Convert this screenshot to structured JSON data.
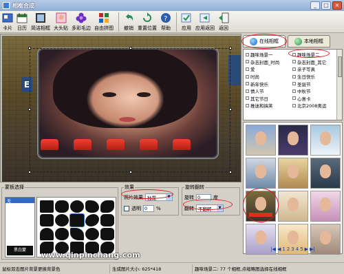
{
  "window": {
    "title": "相框合成",
    "title_icon": "app-icon",
    "controls": [
      "_",
      "□",
      "×"
    ]
  },
  "toolbar": {
    "buttons": [
      {
        "label": "卡片",
        "icon": "card-icon"
      },
      {
        "label": "日历",
        "icon": "calendar-icon"
      },
      {
        "label": "简洁相框",
        "icon": "simple-frame-icon"
      },
      {
        "label": "大头贴",
        "icon": "sticker-icon"
      },
      {
        "label": "多彩毛边",
        "icon": "flower-icon"
      },
      {
        "label": "自由拼图",
        "icon": "puzzle-icon"
      },
      {
        "label": "撤销",
        "icon": "undo-icon"
      },
      {
        "label": "重置位置",
        "icon": "reset-icon"
      },
      {
        "label": "帮助",
        "icon": "help-icon"
      },
      {
        "label": "应用",
        "icon": "apply-icon"
      },
      {
        "label": "应用返回",
        "icon": "apply-return-icon"
      },
      {
        "label": "返回",
        "icon": "return-icon"
      }
    ]
  },
  "right_panel": {
    "tabs": [
      {
        "label": "在线相框",
        "icon": "globe-online-icon",
        "active": true
      },
      {
        "label": "本地相框",
        "icon": "globe-local-icon",
        "active": false
      }
    ],
    "categories": [
      [
        "趣味场景一",
        "趣味场景二"
      ],
      [
        "杂志封面_时尚",
        "杂志封面_其它"
      ],
      [
        "爱",
        "亲子写真"
      ],
      [
        "时尚",
        "生日快乐"
      ],
      [
        "新年快乐",
        "圣诞节"
      ],
      [
        "情人节",
        "中秋节"
      ],
      [
        "其它节日",
        "心意卡"
      ],
      [
        "推迷和搞笑",
        "北京2008奥运"
      ]
    ],
    "pager": {
      "first": "|◀",
      "prev": "◀",
      "pages": [
        "1",
        "2",
        "3",
        "4",
        "5"
      ],
      "next": "▶",
      "last": "▶|"
    }
  },
  "mask_panel": {
    "legend": "蒙板选择",
    "list_items": [
      "无",
      "",
      "",
      "",
      ""
    ],
    "black_button": "黑白蒙"
  },
  "effect_panel": {
    "legend": "效果",
    "photo_effect_label": "照片效果",
    "photo_effect_value": "独霓",
    "transparency_label": "透明",
    "transparency_value": "0",
    "percent": "%"
  },
  "rotate_panel": {
    "legend": "旋转翻转",
    "rotate_label": "旋转",
    "rotate_value": "0",
    "degree": "度",
    "flip_label": "翻转",
    "flip_value": "不翻转"
  },
  "status": {
    "hint": "鼠标双击图片背景更换背景色",
    "size": "生成图片大小: 625*418",
    "info": "趣味场景二: 77 个相框,点缩略图选择在线相框"
  },
  "watermark": "www.qinpinchang.com",
  "accent_red": "#d31b1b"
}
